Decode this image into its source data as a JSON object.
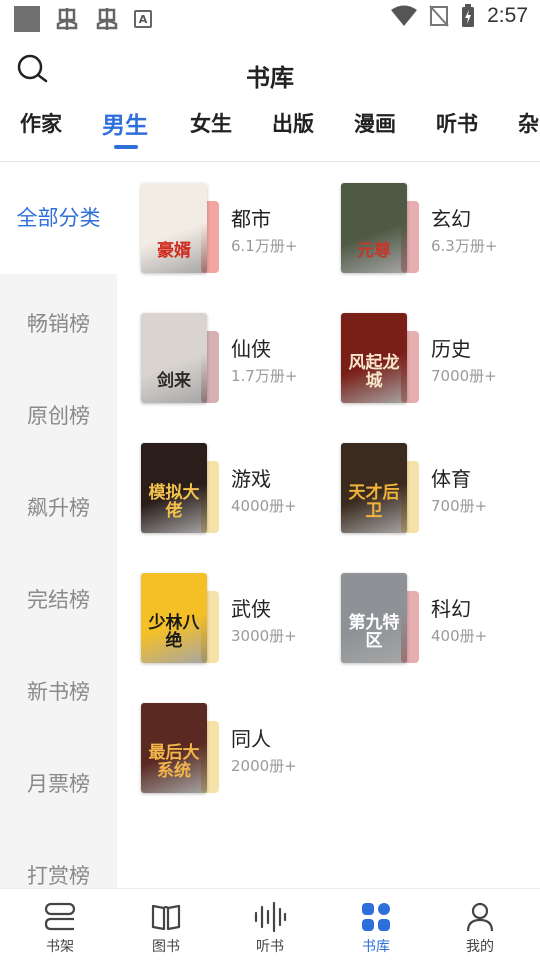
{
  "status_bar": {
    "time": "2:57"
  },
  "header": {
    "title": "书库"
  },
  "tabs": [
    {
      "label": "作家",
      "active": false
    },
    {
      "label": "男生",
      "active": true
    },
    {
      "label": "女生",
      "active": false
    },
    {
      "label": "出版",
      "active": false
    },
    {
      "label": "漫画",
      "active": false
    },
    {
      "label": "听书",
      "active": false
    },
    {
      "label": "杂",
      "active": false
    }
  ],
  "sidebar": {
    "items": [
      {
        "label": "全部分类",
        "active": true
      },
      {
        "label": "畅销榜"
      },
      {
        "label": "原创榜"
      },
      {
        "label": "飙升榜"
      },
      {
        "label": "完结榜"
      },
      {
        "label": "新书榜"
      },
      {
        "label": "月票榜"
      },
      {
        "label": "打赏榜"
      }
    ]
  },
  "categories": [
    {
      "name": "都市",
      "count": "6.1万册+",
      "cover_text": "豪婿",
      "cover_bg": "#f3ece4",
      "cover_fg": "#d02a1e",
      "spine": "#f3a6a0"
    },
    {
      "name": "玄幻",
      "count": "6.3万册+",
      "cover_text": "元尊",
      "cover_bg": "#4f5a45",
      "cover_fg": "#c0392b",
      "spine": "#e6aeb0"
    },
    {
      "name": "仙侠",
      "count": "1.7万册+",
      "cover_text": "剑来",
      "cover_bg": "#d9d4cf",
      "cover_fg": "#2a2a2a",
      "spine": "#d7b0b2"
    },
    {
      "name": "历史",
      "count": "7000册+",
      "cover_text": "风起龙城",
      "cover_bg": "#7a1f17",
      "cover_fg": "#f7e6c9",
      "spine": "#e7aeb0"
    },
    {
      "name": "游戏",
      "count": "4000册+",
      "cover_text": "模拟大佬",
      "cover_bg": "#2a1d1a",
      "cover_fg": "#f2c14e",
      "spine": "#f5e2a8"
    },
    {
      "name": "体育",
      "count": "700册+",
      "cover_text": "天才后卫",
      "cover_bg": "#3b2a1e",
      "cover_fg": "#f1b43a",
      "spine": "#f5e2a8"
    },
    {
      "name": "武侠",
      "count": "3000册+",
      "cover_text": "少林八绝",
      "cover_bg": "#f5c026",
      "cover_fg": "#1a1a1a",
      "spine": "#f5e2a8"
    },
    {
      "name": "科幻",
      "count": "400册+",
      "cover_text": "第九特区",
      "cover_bg": "#8e9296",
      "cover_fg": "#ffffff",
      "spine": "#e7aeb0"
    },
    {
      "name": "同人",
      "count": "2000册+",
      "cover_text": "最后大系统",
      "cover_bg": "#5a2a22",
      "cover_fg": "#f2b64a",
      "spine": "#f5e2a8"
    }
  ],
  "bottom_nav": [
    {
      "label": "书架",
      "icon": "bookshelf-icon",
      "active": false
    },
    {
      "label": "图书",
      "icon": "open-book-icon",
      "active": false
    },
    {
      "label": "听书",
      "icon": "soundwave-icon",
      "active": false
    },
    {
      "label": "书库",
      "icon": "grid-library-icon",
      "active": true
    },
    {
      "label": "我的",
      "icon": "user-icon",
      "active": false
    }
  ],
  "colors": {
    "accent": "#2f6fdb",
    "sidebar_bg": "#f4f4f4",
    "muted_text": "#9a9a9a"
  }
}
